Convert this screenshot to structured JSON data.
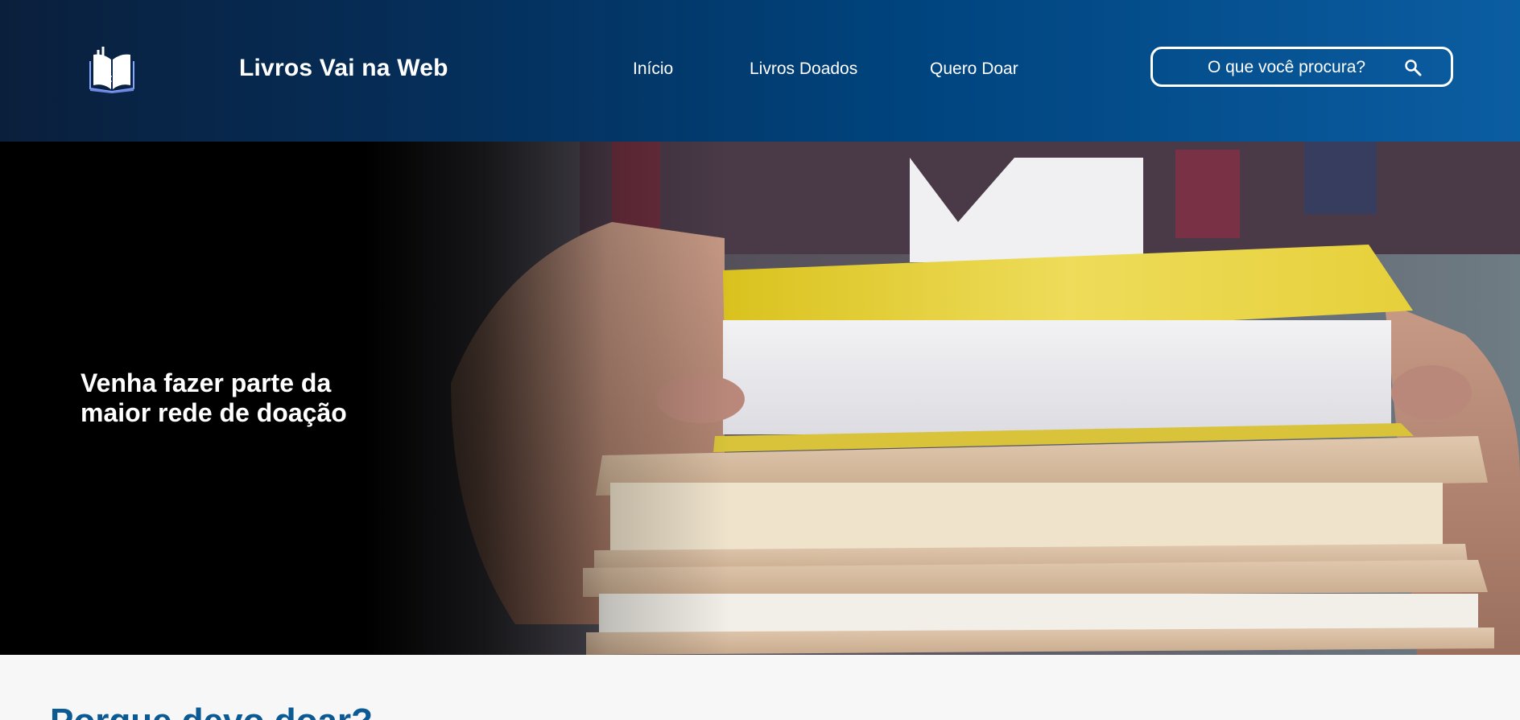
{
  "header": {
    "brand": "Livros Vai na Web",
    "logo_icon": "book-icon",
    "nav": [
      "Início",
      "Livros Doados",
      "Quero Doar"
    ],
    "search": {
      "placeholder": "O que você procura?",
      "icon": "search-icon"
    }
  },
  "hero": {
    "title": "Venha fazer parte da maior rede de doação"
  },
  "section": {
    "title": "Porque devo doar?"
  },
  "colors": {
    "header_start": "#0a1f3c",
    "header_end": "#0b5da2",
    "section_title": "#0b5a93"
  }
}
